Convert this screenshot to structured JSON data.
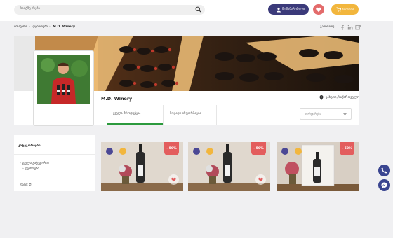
{
  "header": {
    "search_placeholder": "საიტზე ძიება",
    "profile_label": "მომხმარებელი",
    "cart_label": "კალათა"
  },
  "breadcrumb": [
    "მთავარი",
    "ღვინოები",
    "M.D. Winery"
  ],
  "share_label": "გააზიარე",
  "store": {
    "name": "M.D. Winery",
    "location": "კახეთი, საქართველო"
  },
  "tabs": [
    "ყველა პროდუქცია",
    "ზოგადი ინფორმაცია"
  ],
  "sort": {
    "selected": "სორტირება"
  },
  "sidebar": {
    "title": "კატეგორიები",
    "items": [
      "ყველა კატეგორია",
      "ღვინოები"
    ],
    "price_label": "ფასი: ₾"
  },
  "products": [
    {
      "discount": "- 50%"
    },
    {
      "discount": "- 50%"
    },
    {
      "discount": "- 50%"
    }
  ],
  "colors": {
    "accent_purple": "#3b3a7a",
    "sale_red": "#e35d5d",
    "cart_yellow": "#f2b63d",
    "active_tab_green": "#2c9a3d"
  }
}
